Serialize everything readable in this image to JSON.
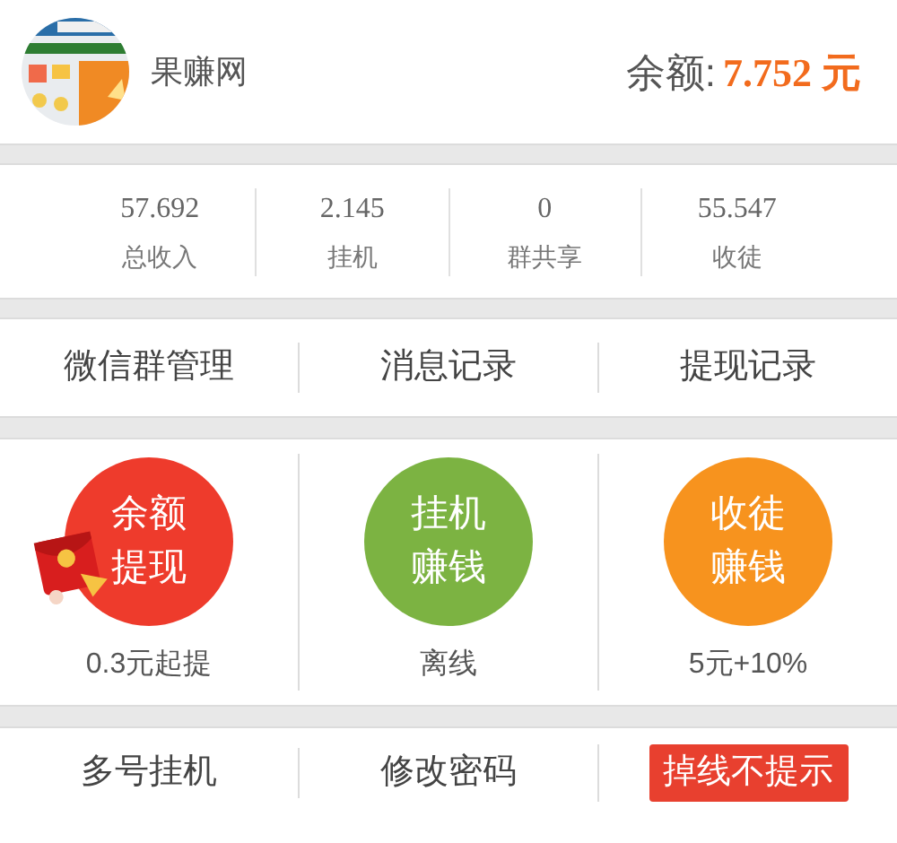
{
  "header": {
    "site_name": "果赚网",
    "balance_label": "余额:",
    "balance_value": "7.752 元"
  },
  "stats": [
    {
      "value": "57.692",
      "label": "总收入"
    },
    {
      "value": "2.145",
      "label": "挂机"
    },
    {
      "value": "0",
      "label": "群共享"
    },
    {
      "value": "55.547",
      "label": "收徒"
    }
  ],
  "menu": [
    "微信群管理",
    "消息记录",
    "提现记录"
  ],
  "tiles": [
    {
      "kind": "envelope",
      "line_1": "余额",
      "line_2": "提现",
      "caption": "0.3元起提",
      "color": "#ee3b2c"
    },
    {
      "kind": "plain",
      "line_1": "挂机",
      "line_2": "赚钱",
      "caption": "离线",
      "color": "#7cb342"
    },
    {
      "kind": "plain",
      "line_1": "收徒",
      "line_2": "赚钱",
      "caption": "5元+10%",
      "color": "#f7931e"
    }
  ],
  "bottom": [
    {
      "kind": "link",
      "label": "多号挂机"
    },
    {
      "kind": "link",
      "label": "修改密码"
    },
    {
      "kind": "toggle",
      "label": "掉线不提示",
      "on": true
    }
  ]
}
